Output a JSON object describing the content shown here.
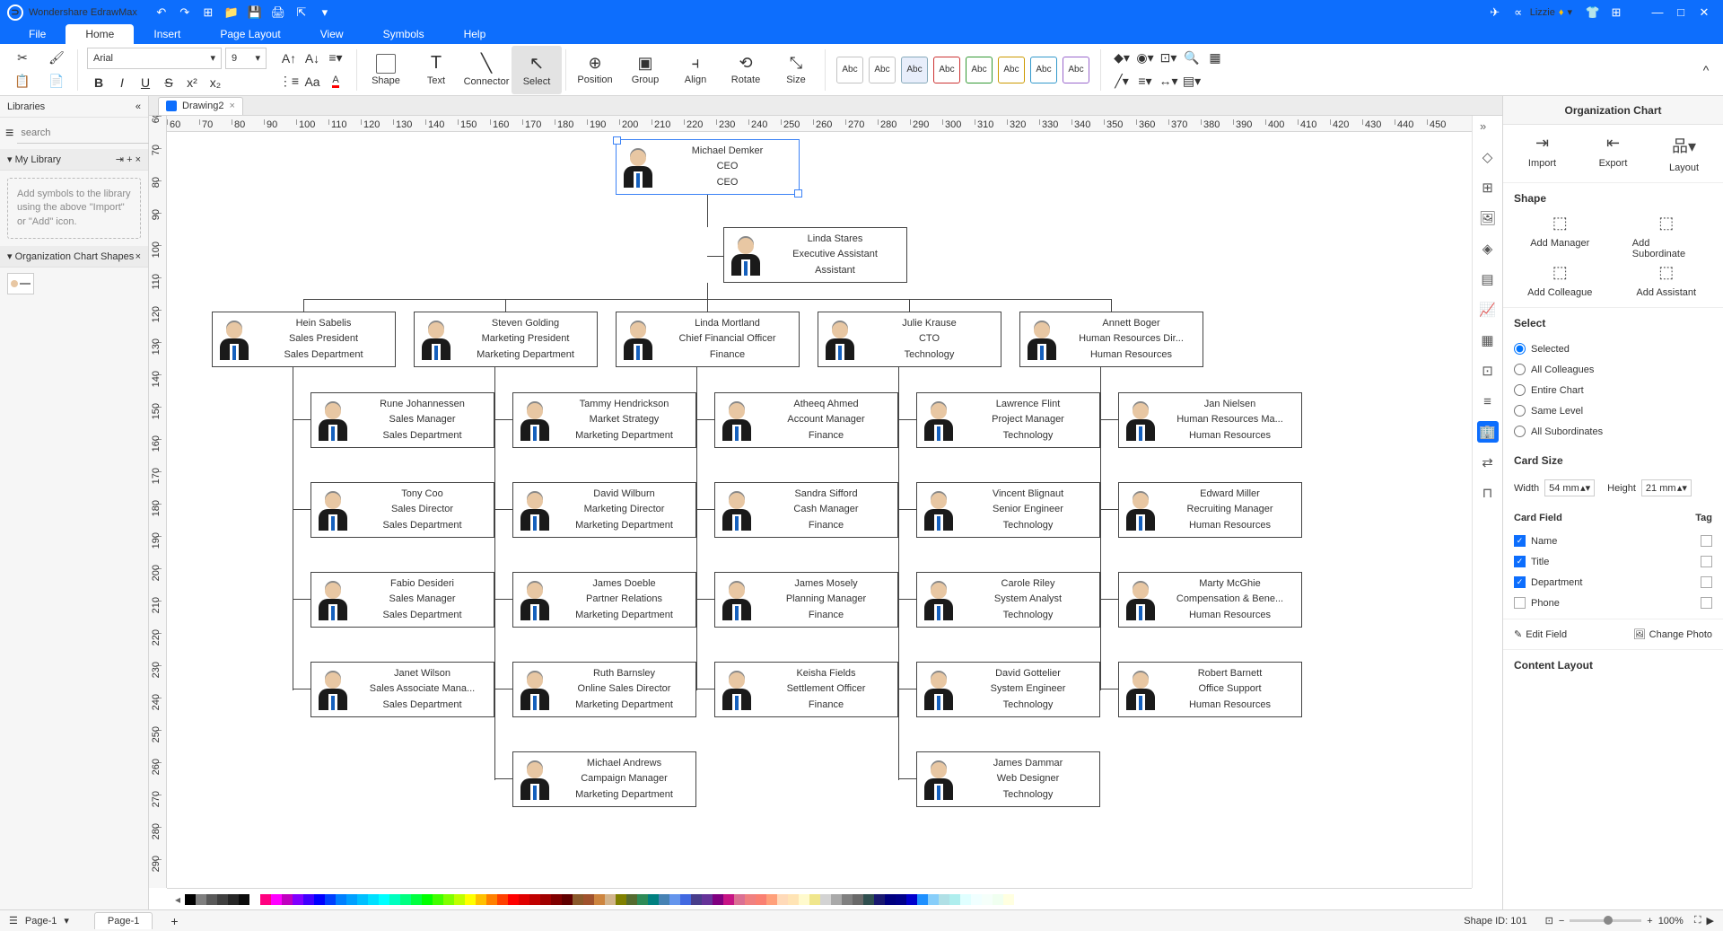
{
  "app": {
    "name": "Wondershare EdrawMax",
    "user": "Lizzie"
  },
  "menu": {
    "items": [
      "File",
      "Home",
      "Insert",
      "Page Layout",
      "View",
      "Symbols",
      "Help"
    ],
    "active": "Home"
  },
  "ribbon": {
    "font_name": "Arial",
    "font_size": "9",
    "big": {
      "shape": "Shape",
      "text": "Text",
      "connector": "Connector",
      "select": "Select",
      "position": "Position",
      "group": "Group",
      "align": "Align",
      "rotate": "Rotate",
      "size": "Size"
    },
    "theme_label": "Abc"
  },
  "left": {
    "title": "Libraries",
    "search_placeholder": "search",
    "mylib": "My Library",
    "hint": "Add symbols to the library using the above \"Import\" or \"Add\" icon.",
    "shapes": "Organization Chart Shapes"
  },
  "tab": {
    "name": "Drawing2"
  },
  "right": {
    "title": "Organization Chart",
    "import": "Import",
    "export": "Export",
    "layout": "Layout",
    "shape_hdr": "Shape",
    "add_manager": "Add Manager",
    "add_subordinate": "Add Subordinate",
    "add_colleague": "Add Colleague",
    "add_assistant": "Add Assistant",
    "select_hdr": "Select",
    "sel_selected": "Selected",
    "sel_allcol": "All Colleagues",
    "sel_entire": "Entire Chart",
    "sel_same": "Same Level",
    "sel_allsub": "All Subordinates",
    "cardsize_hdr": "Card Size",
    "width_lbl": "Width",
    "width_val": "54 mm",
    "height_lbl": "Height",
    "height_val": "21 mm",
    "cardfield": "Card Field",
    "tag": "Tag",
    "f_name": "Name",
    "f_title": "Title",
    "f_dept": "Department",
    "f_phone": "Phone",
    "editfield": "Edit Field",
    "changephoto": "Change Photo",
    "content_layout": "Content Layout"
  },
  "status": {
    "page_lbl": "Page-1",
    "pagetab": "Page-1",
    "shapeid": "Shape ID: 101",
    "zoom": "100%"
  },
  "org": {
    "ceo": {
      "n": "Michael Demker",
      "t": "CEO",
      "d": "CEO"
    },
    "asst": {
      "n": "Linda Stares",
      "t": "Executive Assistant",
      "d": "Assistant"
    },
    "mgrs": [
      {
        "n": "Hein Sabelis",
        "t": "Sales President",
        "d": "Sales Department"
      },
      {
        "n": "Steven Golding",
        "t": "Marketing President",
        "d": "Marketing Department"
      },
      {
        "n": "Linda Mortland",
        "t": "Chief Financial Officer",
        "d": "Finance"
      },
      {
        "n": "Julie Krause",
        "t": "CTO",
        "d": "Technology"
      },
      {
        "n": "Annett Boger",
        "t": "Human Resources Dir...",
        "d": "Human Resources"
      }
    ],
    "subs": [
      [
        {
          "n": "Rune Johannessen",
          "t": "Sales Manager",
          "d": "Sales Department"
        },
        {
          "n": "Tony Coo",
          "t": "Sales Director",
          "d": "Sales Department"
        },
        {
          "n": "Fabio Desideri",
          "t": "Sales Manager",
          "d": "Sales Department"
        },
        {
          "n": "Janet Wilson",
          "t": "Sales Associate Mana...",
          "d": "Sales Department"
        }
      ],
      [
        {
          "n": "Tammy Hendrickson",
          "t": "Market Strategy",
          "d": "Marketing Department"
        },
        {
          "n": "David Wilburn",
          "t": "Marketing Director",
          "d": "Marketing Department"
        },
        {
          "n": "James Doeble",
          "t": "Partner Relations",
          "d": "Marketing Department"
        },
        {
          "n": "Ruth Barnsley",
          "t": "Online Sales Director",
          "d": "Marketing Department"
        },
        {
          "n": "Michael Andrews",
          "t": "Campaign Manager",
          "d": "Marketing Department"
        }
      ],
      [
        {
          "n": "Atheeq Ahmed",
          "t": "Account Manager",
          "d": "Finance"
        },
        {
          "n": "Sandra Sifford",
          "t": "Cash Manager",
          "d": "Finance"
        },
        {
          "n": "James Mosely",
          "t": "Planning Manager",
          "d": "Finance"
        },
        {
          "n": "Keisha Fields",
          "t": "Settlement Officer",
          "d": "Finance"
        }
      ],
      [
        {
          "n": "Lawrence Flint",
          "t": "Project Manager",
          "d": "Technology"
        },
        {
          "n": "Vincent Blignaut",
          "t": "Senior Engineer",
          "d": "Technology"
        },
        {
          "n": "Carole Riley",
          "t": "System Analyst",
          "d": "Technology"
        },
        {
          "n": "David Gottelier",
          "t": "System Engineer",
          "d": "Technology"
        },
        {
          "n": "James Dammar",
          "t": "Web Designer",
          "d": "Technology"
        }
      ],
      [
        {
          "n": "Jan Nielsen",
          "t": "Human Resources Ma...",
          "d": "Human Resources"
        },
        {
          "n": "Edward Miller",
          "t": "Recruiting Manager",
          "d": "Human Resources"
        },
        {
          "n": "Marty McGhie",
          "t": "Compensation & Bene...",
          "d": "Human Resources"
        },
        {
          "n": "Robert Barnett",
          "t": "Office Support",
          "d": "Human Resources"
        }
      ]
    ]
  },
  "colors": {
    "row": [
      "#000",
      "#7f7f7f",
      "#595959",
      "#3f3f3f",
      "#262626",
      "#0c0c0c",
      "#fff",
      "#ff0080",
      "#ff00ff",
      "#c000c0",
      "#8000ff",
      "#4000ff",
      "#0000ff",
      "#0040ff",
      "#0080ff",
      "#00a0ff",
      "#00c0ff",
      "#00e0ff",
      "#00ffff",
      "#00ffbf",
      "#00ff80",
      "#00ff40",
      "#00ff00",
      "#40ff00",
      "#80ff00",
      "#bfff00",
      "#ffff00",
      "#ffc000",
      "#ff8000",
      "#ff4000",
      "#ff0000",
      "#e00000",
      "#c00000",
      "#a00000",
      "#800000",
      "#600000",
      "#8b5a2b",
      "#a0522d",
      "#cd853f",
      "#d2b48c",
      "#808000",
      "#556b2f",
      "#2e8b57",
      "#008080",
      "#4682b4",
      "#6495ed",
      "#4169e1",
      "#483d8b",
      "#663399",
      "#800080",
      "#c71585",
      "#db7093",
      "#f08080",
      "#fa8072",
      "#ffa07a",
      "#ffdab9",
      "#ffe4b5",
      "#fffacd",
      "#f0e68c",
      "#d3d3d3",
      "#a9a9a9",
      "#808080",
      "#696969",
      "#2f4f4f",
      "#191970",
      "#000080",
      "#00008b",
      "#0000cd",
      "#1e90ff",
      "#87cefa",
      "#b0e0e6",
      "#afeeee",
      "#e0ffff",
      "#f0ffff",
      "#f5fffa",
      "#f0fff0",
      "#ffffe0"
    ]
  }
}
